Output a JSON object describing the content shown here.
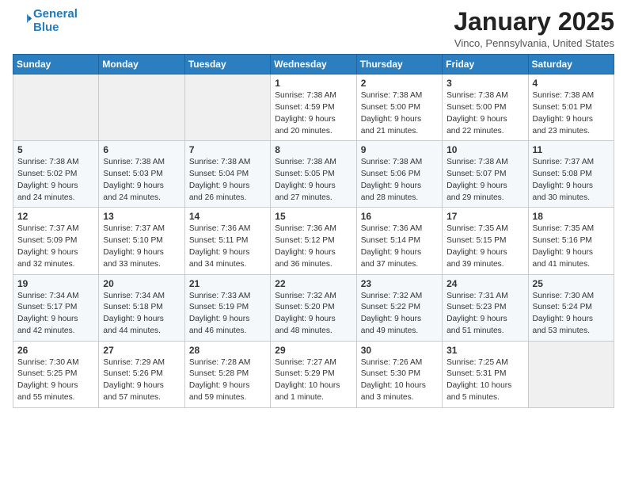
{
  "header": {
    "logo_line1": "General",
    "logo_line2": "Blue",
    "month_title": "January 2025",
    "location": "Vinco, Pennsylvania, United States"
  },
  "weekdays": [
    "Sunday",
    "Monday",
    "Tuesday",
    "Wednesday",
    "Thursday",
    "Friday",
    "Saturday"
  ],
  "weeks": [
    [
      {
        "day": "",
        "content": ""
      },
      {
        "day": "",
        "content": ""
      },
      {
        "day": "",
        "content": ""
      },
      {
        "day": "1",
        "content": "Sunrise: 7:38 AM\nSunset: 4:59 PM\nDaylight: 9 hours\nand 20 minutes."
      },
      {
        "day": "2",
        "content": "Sunrise: 7:38 AM\nSunset: 5:00 PM\nDaylight: 9 hours\nand 21 minutes."
      },
      {
        "day": "3",
        "content": "Sunrise: 7:38 AM\nSunset: 5:00 PM\nDaylight: 9 hours\nand 22 minutes."
      },
      {
        "day": "4",
        "content": "Sunrise: 7:38 AM\nSunset: 5:01 PM\nDaylight: 9 hours\nand 23 minutes."
      }
    ],
    [
      {
        "day": "5",
        "content": "Sunrise: 7:38 AM\nSunset: 5:02 PM\nDaylight: 9 hours\nand 24 minutes."
      },
      {
        "day": "6",
        "content": "Sunrise: 7:38 AM\nSunset: 5:03 PM\nDaylight: 9 hours\nand 24 minutes."
      },
      {
        "day": "7",
        "content": "Sunrise: 7:38 AM\nSunset: 5:04 PM\nDaylight: 9 hours\nand 26 minutes."
      },
      {
        "day": "8",
        "content": "Sunrise: 7:38 AM\nSunset: 5:05 PM\nDaylight: 9 hours\nand 27 minutes."
      },
      {
        "day": "9",
        "content": "Sunrise: 7:38 AM\nSunset: 5:06 PM\nDaylight: 9 hours\nand 28 minutes."
      },
      {
        "day": "10",
        "content": "Sunrise: 7:38 AM\nSunset: 5:07 PM\nDaylight: 9 hours\nand 29 minutes."
      },
      {
        "day": "11",
        "content": "Sunrise: 7:37 AM\nSunset: 5:08 PM\nDaylight: 9 hours\nand 30 minutes."
      }
    ],
    [
      {
        "day": "12",
        "content": "Sunrise: 7:37 AM\nSunset: 5:09 PM\nDaylight: 9 hours\nand 32 minutes."
      },
      {
        "day": "13",
        "content": "Sunrise: 7:37 AM\nSunset: 5:10 PM\nDaylight: 9 hours\nand 33 minutes."
      },
      {
        "day": "14",
        "content": "Sunrise: 7:36 AM\nSunset: 5:11 PM\nDaylight: 9 hours\nand 34 minutes."
      },
      {
        "day": "15",
        "content": "Sunrise: 7:36 AM\nSunset: 5:12 PM\nDaylight: 9 hours\nand 36 minutes."
      },
      {
        "day": "16",
        "content": "Sunrise: 7:36 AM\nSunset: 5:14 PM\nDaylight: 9 hours\nand 37 minutes."
      },
      {
        "day": "17",
        "content": "Sunrise: 7:35 AM\nSunset: 5:15 PM\nDaylight: 9 hours\nand 39 minutes."
      },
      {
        "day": "18",
        "content": "Sunrise: 7:35 AM\nSunset: 5:16 PM\nDaylight: 9 hours\nand 41 minutes."
      }
    ],
    [
      {
        "day": "19",
        "content": "Sunrise: 7:34 AM\nSunset: 5:17 PM\nDaylight: 9 hours\nand 42 minutes."
      },
      {
        "day": "20",
        "content": "Sunrise: 7:34 AM\nSunset: 5:18 PM\nDaylight: 9 hours\nand 44 minutes."
      },
      {
        "day": "21",
        "content": "Sunrise: 7:33 AM\nSunset: 5:19 PM\nDaylight: 9 hours\nand 46 minutes."
      },
      {
        "day": "22",
        "content": "Sunrise: 7:32 AM\nSunset: 5:20 PM\nDaylight: 9 hours\nand 48 minutes."
      },
      {
        "day": "23",
        "content": "Sunrise: 7:32 AM\nSunset: 5:22 PM\nDaylight: 9 hours\nand 49 minutes."
      },
      {
        "day": "24",
        "content": "Sunrise: 7:31 AM\nSunset: 5:23 PM\nDaylight: 9 hours\nand 51 minutes."
      },
      {
        "day": "25",
        "content": "Sunrise: 7:30 AM\nSunset: 5:24 PM\nDaylight: 9 hours\nand 53 minutes."
      }
    ],
    [
      {
        "day": "26",
        "content": "Sunrise: 7:30 AM\nSunset: 5:25 PM\nDaylight: 9 hours\nand 55 minutes."
      },
      {
        "day": "27",
        "content": "Sunrise: 7:29 AM\nSunset: 5:26 PM\nDaylight: 9 hours\nand 57 minutes."
      },
      {
        "day": "28",
        "content": "Sunrise: 7:28 AM\nSunset: 5:28 PM\nDaylight: 9 hours\nand 59 minutes."
      },
      {
        "day": "29",
        "content": "Sunrise: 7:27 AM\nSunset: 5:29 PM\nDaylight: 10 hours\nand 1 minute."
      },
      {
        "day": "30",
        "content": "Sunrise: 7:26 AM\nSunset: 5:30 PM\nDaylight: 10 hours\nand 3 minutes."
      },
      {
        "day": "31",
        "content": "Sunrise: 7:25 AM\nSunset: 5:31 PM\nDaylight: 10 hours\nand 5 minutes."
      },
      {
        "day": "",
        "content": ""
      }
    ]
  ]
}
